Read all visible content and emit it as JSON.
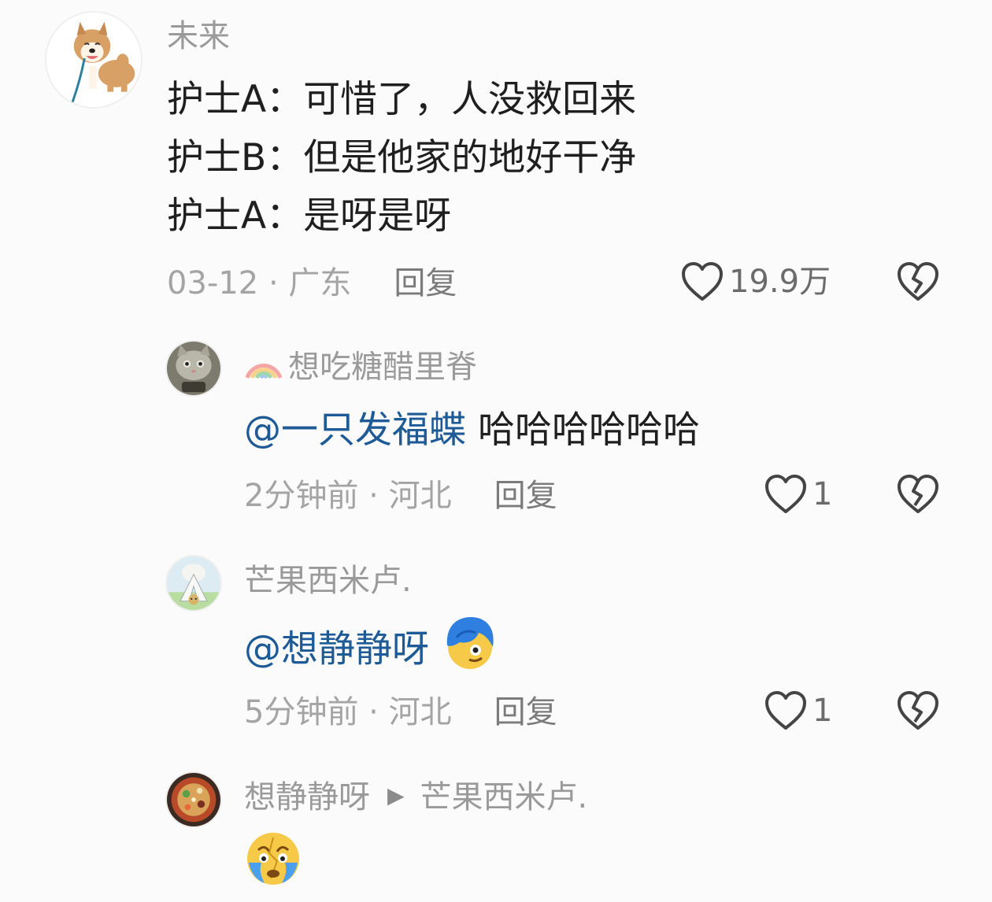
{
  "comments": [
    {
      "username": "未来",
      "lines": [
        "护士A：可惜了，人没救回来",
        "护士B：但是他家的地好干净",
        "护士A：是呀是呀"
      ],
      "date": "03-12",
      "location": "广东",
      "reply_label": "回复",
      "likes": "19.9万"
    },
    {
      "username": "想吃糖醋里脊",
      "mention": "@一只发福蝶",
      "text": "哈哈哈哈哈哈",
      "date": "2分钟前",
      "location": "河北",
      "reply_label": "回复",
      "likes": "1"
    },
    {
      "username": "芒果西米卢.",
      "mention": "@想静静呀",
      "date": "5分钟前",
      "location": "河北",
      "reply_label": "回复",
      "likes": "1"
    },
    {
      "username": "想静静呀",
      "reply_to": "芒果西米卢."
    }
  ],
  "separator": " · ",
  "colors": {
    "background": "#fbfbfb",
    "mention": "#1d5a96",
    "text": "#1f1f1f",
    "meta": "#a4a4a4"
  },
  "icons": [
    "heart-icon",
    "broken-heart-icon",
    "rainbow-icon",
    "reply-arrow-icon"
  ]
}
